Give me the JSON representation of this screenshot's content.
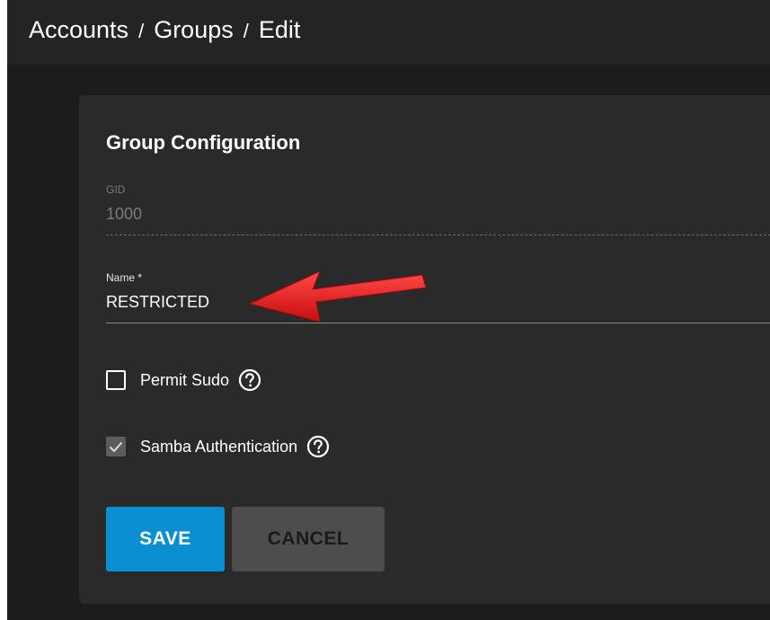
{
  "breadcrumb": {
    "items": [
      "Accounts",
      "Groups",
      "Edit"
    ],
    "separator": "/"
  },
  "card": {
    "title": "Group Configuration"
  },
  "fields": {
    "gid": {
      "label": "GID",
      "value": "1000",
      "disabled": true
    },
    "name": {
      "label": "Name *",
      "value": "RESTRICTED"
    }
  },
  "checkboxes": {
    "permit_sudo": {
      "label": "Permit Sudo",
      "checked": false
    },
    "samba_auth": {
      "label": "Samba Authentication",
      "checked": true
    }
  },
  "buttons": {
    "save_label": "SAVE",
    "cancel_label": "CANCEL"
  },
  "icons": {
    "help": "help-circle-icon",
    "check": "checkmark-icon",
    "annotation": "red-arrow-annotation"
  },
  "colors": {
    "primary": "#0b8fd3",
    "annotation": "#e0191b",
    "background": "#1c1c1c",
    "card": "#2a2a2a"
  }
}
